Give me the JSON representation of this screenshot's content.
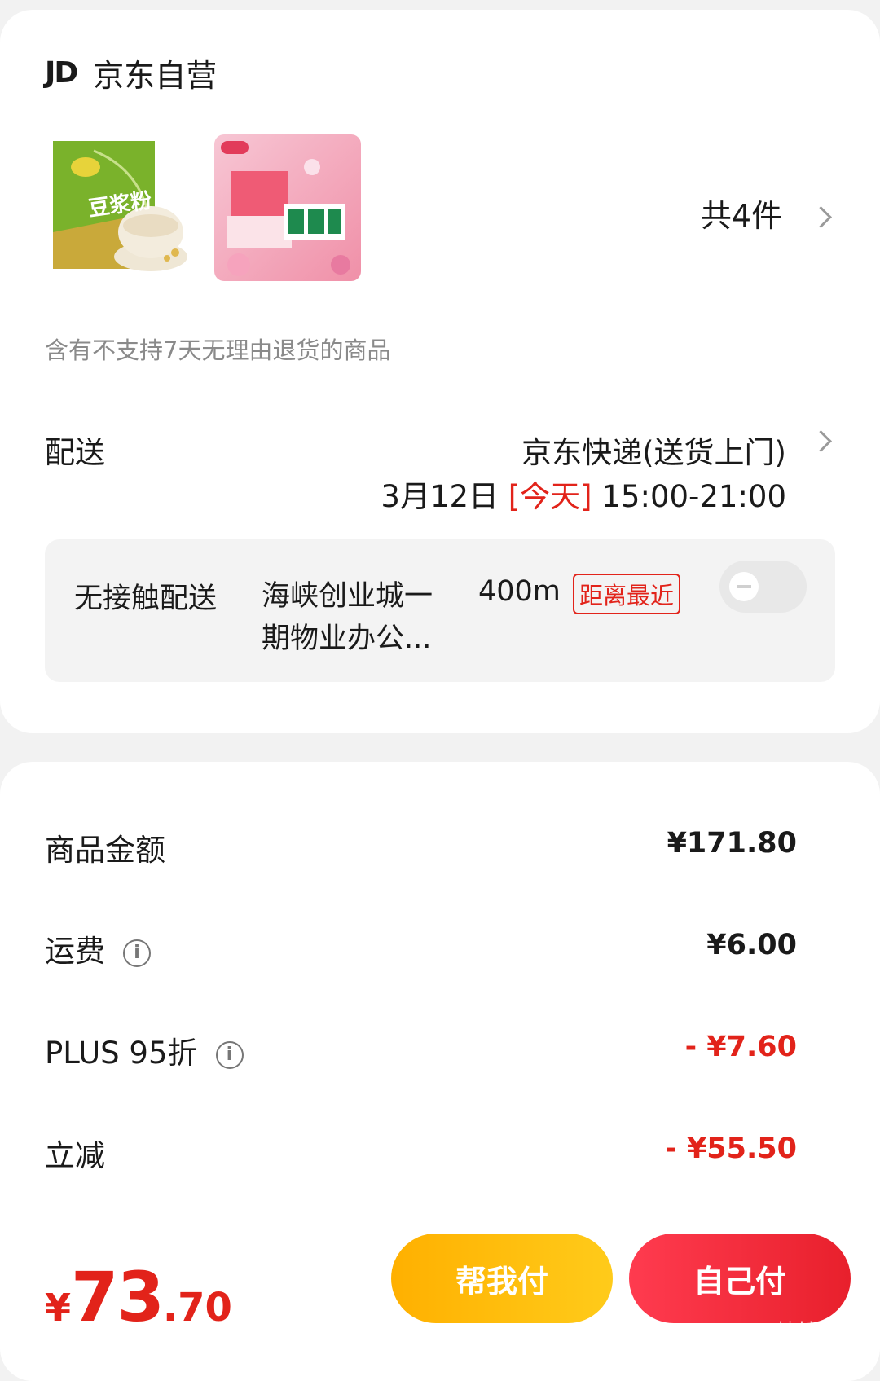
{
  "store": {
    "logo": "JD",
    "name": "京东自营"
  },
  "products": {
    "item1_name": "豆浆粉",
    "count_label": "共4件",
    "return_notice": "含有不支持7天无理由退货的商品"
  },
  "delivery": {
    "label": "配送",
    "method": "京东快递(送货上门)",
    "date": "3月12日",
    "today_tag": "[今天]",
    "time_window": "15:00-21:00"
  },
  "contactless": {
    "label": "无接触配送",
    "address": "海峡创业城一期物业办公...",
    "distance": "400m",
    "badge": "距离最近",
    "enabled": false
  },
  "summary": {
    "rows": [
      {
        "label": "商品金额",
        "value": "¥171.80",
        "red": false,
        "info": false
      },
      {
        "label": "运费",
        "value": "¥6.00",
        "red": false,
        "info": true
      },
      {
        "label": "PLUS 95折",
        "value": "- ¥7.60",
        "red": true,
        "info": true
      },
      {
        "label": "立减",
        "value": "- ¥55.50",
        "red": true,
        "info": false
      }
    ]
  },
  "footer": {
    "total_symbol": "¥",
    "total_int": "73",
    "total_dec": ".70",
    "help_pay_label": "帮我付",
    "self_pay_label": "自己付",
    "watermark": "zhizhizhi.com"
  },
  "colors": {
    "accent_red": "#e2231a",
    "help_yellow": "#ffbb0a",
    "pay_red": "#f02a3a"
  }
}
